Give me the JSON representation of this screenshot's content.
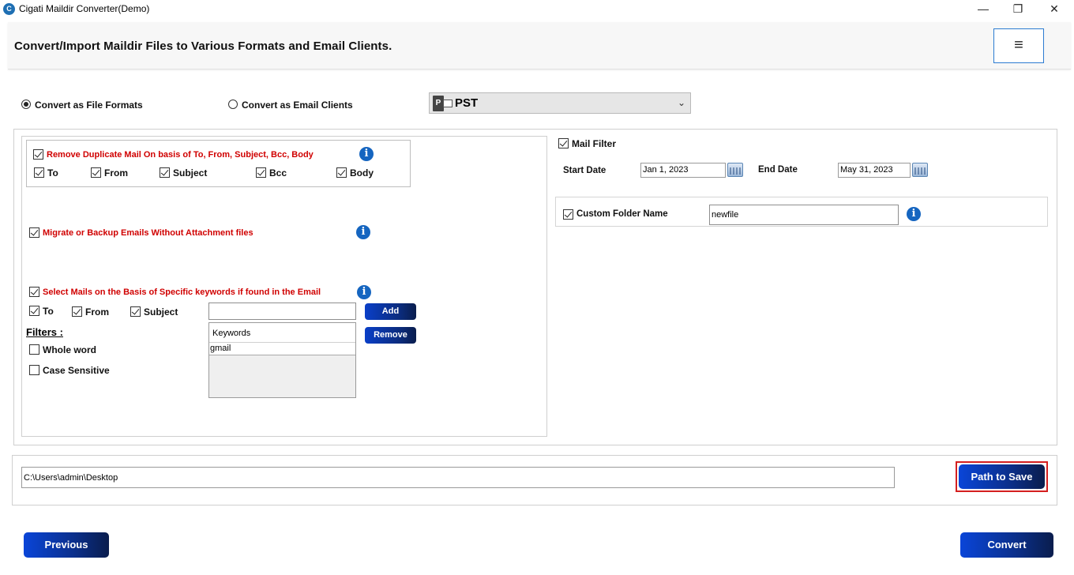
{
  "window": {
    "title": "Cigati Maildir Converter(Demo)",
    "minimize": "—",
    "maximize": "❐",
    "close": "✕"
  },
  "header": {
    "title": "Convert/Import Maildir Files to Various Formats and Email Clients.",
    "menu_icon": "≡"
  },
  "mode": {
    "file_formats_label": "Convert as File Formats",
    "email_clients_label": "Convert as Email Clients",
    "selected": "file_formats"
  },
  "format_select": {
    "value": "PST",
    "icon_letter": "P"
  },
  "duplicate": {
    "label": "Remove Duplicate Mail On basis of To, From, Subject, Bcc, Body",
    "checked": true,
    "fields": [
      {
        "label": "To",
        "checked": true
      },
      {
        "label": "From",
        "checked": true
      },
      {
        "label": "Subject",
        "checked": true
      },
      {
        "label": "Bcc",
        "checked": true
      },
      {
        "label": "Body",
        "checked": true
      }
    ]
  },
  "attachments": {
    "label": "Migrate or Backup Emails Without Attachment files",
    "checked": true
  },
  "keywords": {
    "label": "Select Mails on the Basis of Specific keywords if found in the Email",
    "checked": true,
    "fields": [
      {
        "label": "To",
        "checked": true
      },
      {
        "label": "From",
        "checked": true
      },
      {
        "label": "Subject",
        "checked": true
      }
    ],
    "input_value": "",
    "add_label": "Add",
    "remove_label": "Remove",
    "list_header": "Keywords",
    "items": [
      "gmail"
    ]
  },
  "filters": {
    "title": "Filters :",
    "whole_word": "Whole word",
    "case_sensitive": "Case Sensitive"
  },
  "mail_filter": {
    "label": "Mail Filter",
    "checked": true,
    "start_label": "Start Date",
    "start_value": "Jan 1, 2023",
    "end_label": "End Date",
    "end_value": "May 31, 2023"
  },
  "custom_folder": {
    "label": "Custom Folder Name",
    "checked": true,
    "value": "newfile"
  },
  "info_icon": "i",
  "save_path": {
    "value": "C:\\Users\\admin\\Desktop",
    "button_label": "Path to Save"
  },
  "footer": {
    "previous_label": "Previous",
    "convert_label": "Convert"
  }
}
